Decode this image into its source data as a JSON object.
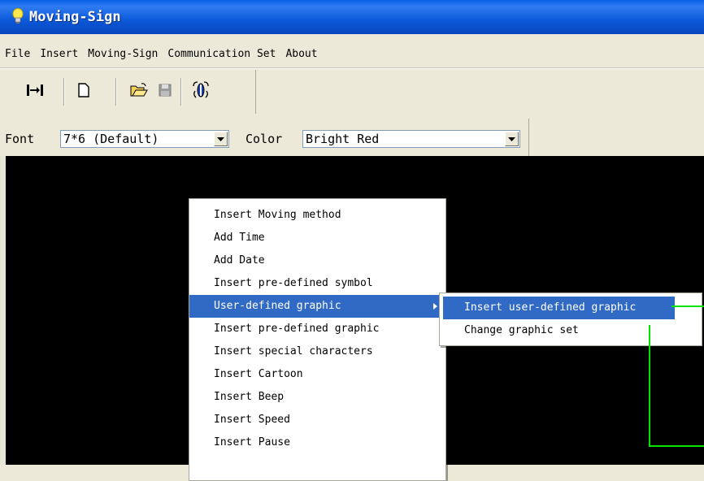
{
  "window": {
    "title": "Moving-Sign"
  },
  "menubar": {
    "items": [
      "File",
      "Insert",
      "Moving-Sign",
      "Communication Set",
      "About"
    ]
  },
  "toolbar": {
    "buttons": [
      "connect-icon",
      "new-file-icon",
      "open-folder-icon",
      "save-icon",
      "send-icon"
    ]
  },
  "fontbar": {
    "font_label": "Font",
    "font_value": "7*6 (Default)",
    "color_label": "Color",
    "color_value": "Bright Red"
  },
  "context_menu": {
    "items": [
      "Insert Moving method",
      "Add Time",
      "Add Date",
      "Insert pre-defined symbol",
      "User-defined graphic",
      "Insert pre-defined graphic",
      "Insert special characters",
      "Insert Cartoon",
      "Insert Beep",
      "Insert Speed",
      "Insert Pause"
    ],
    "highlighted": "User-defined graphic"
  },
  "submenu": {
    "items": [
      "Insert user-defined graphic",
      "Change graphic set"
    ],
    "highlighted": "Insert user-defined graphic"
  },
  "colors": {
    "highlight": "#316ac5",
    "canvas": "#000000",
    "annotation": "#00e400",
    "titlebar": "#0b58d8"
  }
}
